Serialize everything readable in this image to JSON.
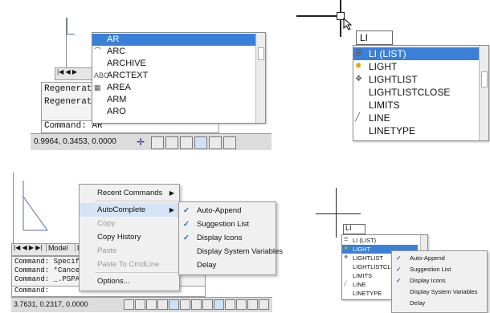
{
  "panel1": {
    "history": [
      "Regenerat",
      "Regenerat"
    ],
    "command_line": "Command:  AR",
    "coordinates": "0.9964, 0.3453, 0.0000",
    "suggestions": [
      "AR",
      "ARC",
      "ARCHIVE",
      "ARCTEXT",
      "AREA",
      "ARM",
      "ARO"
    ],
    "selected_index": 0
  },
  "panel2": {
    "input_value": "LI",
    "suggestions": [
      "LI (LIST)",
      "LIGHT",
      "LIGHTLIST",
      "LIGHTLISTCLOSE",
      "LIMITS",
      "LINE",
      "LINETYPE"
    ],
    "selected_index": 0
  },
  "panel3": {
    "tabs": [
      "Model",
      "L"
    ],
    "history": [
      "Command: Specif",
      "Command: *Cance",
      "Command: _.PSPA"
    ],
    "command_line": "Command:",
    "coordinates": "3.7631, 0.2317, 0.0000",
    "menu": [
      {
        "label": "Recent Commands",
        "submenu": true,
        "disabled": false
      },
      {
        "label": "AutoComplete",
        "submenu": true,
        "disabled": false
      },
      {
        "label": "Copy",
        "submenu": false,
        "disabled": true
      },
      {
        "label": "Copy History",
        "submenu": false,
        "disabled": false
      },
      {
        "label": "Paste",
        "submenu": false,
        "disabled": true
      },
      {
        "label": "Paste To CmdLine",
        "submenu": false,
        "disabled": true
      },
      {
        "label": "Options...",
        "submenu": false,
        "disabled": false
      }
    ],
    "submenu": [
      {
        "label": "Auto-Append",
        "checked": true
      },
      {
        "label": "Suggestion List",
        "checked": true
      },
      {
        "label": "Display Icons",
        "checked": true
      },
      {
        "label": "Display System Variables",
        "checked": false
      },
      {
        "label": "Delay",
        "checked": false
      }
    ]
  },
  "panel4": {
    "input_value": "LI",
    "suggestions": [
      "LI (LIST)",
      "LIGHT",
      "LIGHTLIST",
      "LIGHTLISTCLOSE",
      "LIMITS",
      "LINE",
      "LINETYPE"
    ],
    "selected_index": 1,
    "submenu": [
      {
        "label": "Auto-Append",
        "checked": true
      },
      {
        "label": "Suggestion List",
        "checked": true
      },
      {
        "label": "Display Icons",
        "checked": true
      },
      {
        "label": "Display System Variables",
        "checked": false
      },
      {
        "label": "Delay",
        "checked": false
      }
    ]
  },
  "colors": {
    "selection": "#3a80d8",
    "check": "#2b5fb5",
    "highlight": "#d6e4f7"
  }
}
